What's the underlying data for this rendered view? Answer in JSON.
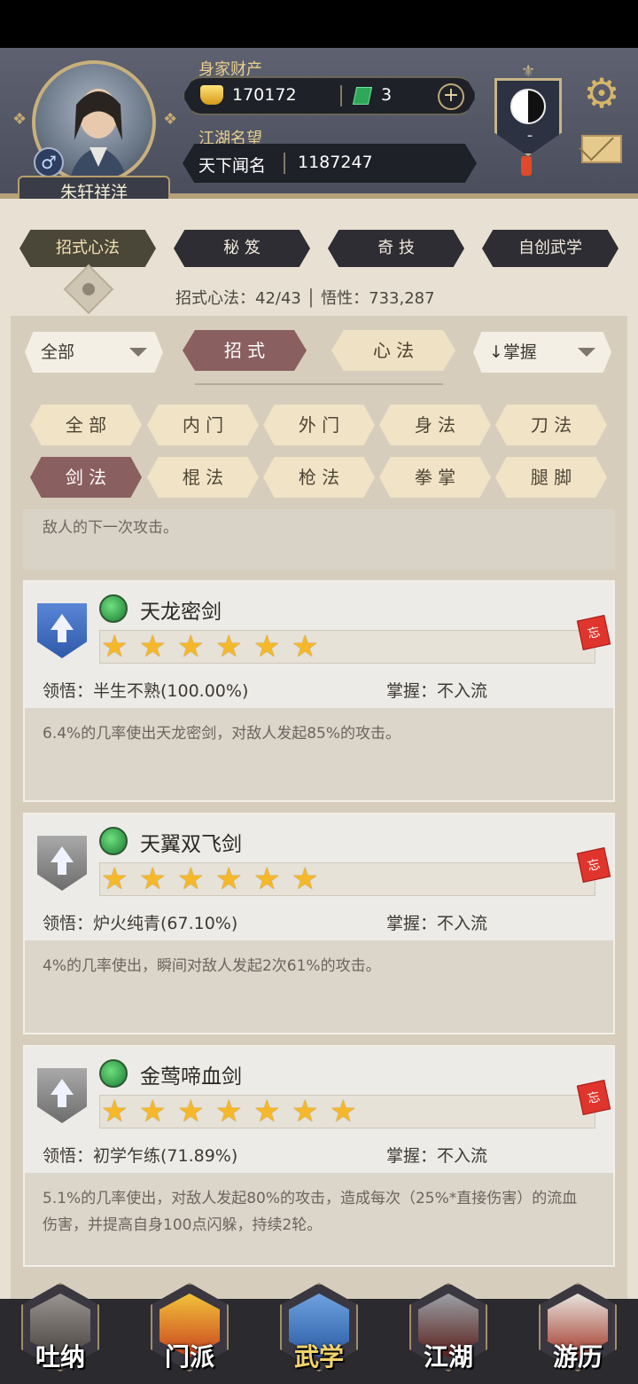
{
  "header": {
    "wealth_label": "身家财产",
    "gold": "170172",
    "jade": "3",
    "plus": "+",
    "reputation_label": "江湖名望",
    "reputation_title": "天下闻名",
    "reputation_value": "1187247",
    "player_name": "朱轩祥洋",
    "gender_symbol": "♂",
    "sect_rank": "-"
  },
  "tabs": [
    {
      "label": "招式心法",
      "active": true
    },
    {
      "label": "秘 笈",
      "active": false
    },
    {
      "label": "奇 技",
      "active": false
    },
    {
      "label": "自创武学",
      "active": false
    }
  ],
  "stats": {
    "text": "招式心法：42/43 │ 悟性：733,287"
  },
  "filters": {
    "scope": "全部",
    "type_moves": "招 式",
    "type_methods": "心 法",
    "sort": "↓掌握"
  },
  "categories": [
    {
      "label": "全 部",
      "active": false
    },
    {
      "label": "内 门",
      "active": false
    },
    {
      "label": "外 门",
      "active": false
    },
    {
      "label": "身 法",
      "active": false
    },
    {
      "label": "刀 法",
      "active": false
    },
    {
      "label": "剑 法",
      "active": true
    },
    {
      "label": "棍 法",
      "active": false
    },
    {
      "label": "枪 法",
      "active": false
    },
    {
      "label": "拳 掌",
      "active": false
    },
    {
      "label": "腿 脚",
      "active": false
    }
  ],
  "prev_card_desc": "敌人的下一次攻击。",
  "skills": [
    {
      "name": "天龙密剑",
      "stars": 6,
      "shield": "blue",
      "comprehension": "领悟：半生不熟(100.00%)",
      "mastery": "掌握：不入流",
      "forget": "忘",
      "desc": "6.4%的几率使出天龙密剑，对敌人发起85%的攻击。"
    },
    {
      "name": "天翼双飞剑",
      "stars": 6,
      "shield": "grey",
      "comprehension": "领悟：炉火纯青(67.10%)",
      "mastery": "掌握：不入流",
      "forget": "忘",
      "desc": "4%的几率使出，瞬间对敌人发起2次61%的攻击。"
    },
    {
      "name": "金莺啼血剑",
      "stars": 7,
      "shield": "grey",
      "comprehension": "领悟：初学乍练(71.89%)",
      "mastery": "掌握：不入流",
      "forget": "忘",
      "desc": "5.1%的几率使出，对敌人发起80%的攻击，造成每次（25%*直接伤害）的流血伤害，并提高自身100点闪躲，持续2轮。"
    }
  ],
  "nav": [
    {
      "label": "吐纳",
      "active": false
    },
    {
      "label": "门派",
      "active": false
    },
    {
      "label": "武学",
      "active": true
    },
    {
      "label": "江湖",
      "active": false
    },
    {
      "label": "游历",
      "active": false
    }
  ],
  "colors": {
    "accent": "#8a5f60",
    "gold_text": "#e8cf8e",
    "star": "#f5b82a"
  }
}
